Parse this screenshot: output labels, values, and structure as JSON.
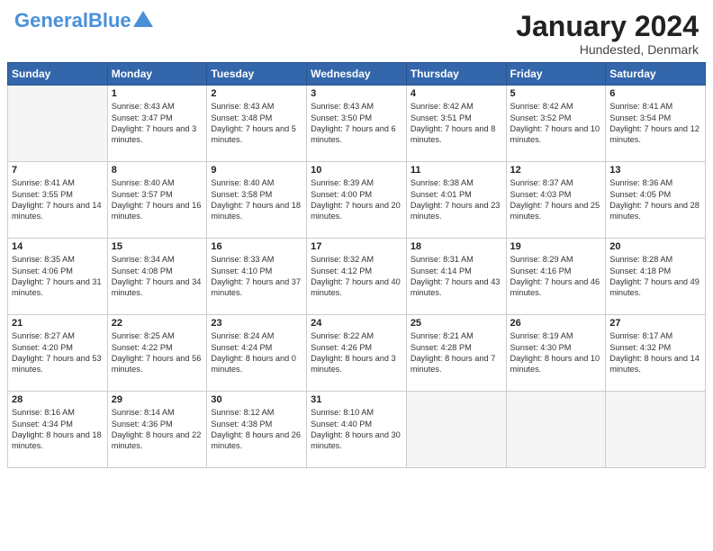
{
  "header": {
    "logo_line1": "General",
    "logo_line2": "Blue",
    "month_title": "January 2024",
    "location": "Hundested, Denmark"
  },
  "weekdays": [
    "Sunday",
    "Monday",
    "Tuesday",
    "Wednesday",
    "Thursday",
    "Friday",
    "Saturday"
  ],
  "weeks": [
    [
      {
        "day": "",
        "sunrise": "",
        "sunset": "",
        "daylight": ""
      },
      {
        "day": "1",
        "sunrise": "Sunrise: 8:43 AM",
        "sunset": "Sunset: 3:47 PM",
        "daylight": "Daylight: 7 hours and 3 minutes."
      },
      {
        "day": "2",
        "sunrise": "Sunrise: 8:43 AM",
        "sunset": "Sunset: 3:48 PM",
        "daylight": "Daylight: 7 hours and 5 minutes."
      },
      {
        "day": "3",
        "sunrise": "Sunrise: 8:43 AM",
        "sunset": "Sunset: 3:50 PM",
        "daylight": "Daylight: 7 hours and 6 minutes."
      },
      {
        "day": "4",
        "sunrise": "Sunrise: 8:42 AM",
        "sunset": "Sunset: 3:51 PM",
        "daylight": "Daylight: 7 hours and 8 minutes."
      },
      {
        "day": "5",
        "sunrise": "Sunrise: 8:42 AM",
        "sunset": "Sunset: 3:52 PM",
        "daylight": "Daylight: 7 hours and 10 minutes."
      },
      {
        "day": "6",
        "sunrise": "Sunrise: 8:41 AM",
        "sunset": "Sunset: 3:54 PM",
        "daylight": "Daylight: 7 hours and 12 minutes."
      }
    ],
    [
      {
        "day": "7",
        "sunrise": "Sunrise: 8:41 AM",
        "sunset": "Sunset: 3:55 PM",
        "daylight": "Daylight: 7 hours and 14 minutes."
      },
      {
        "day": "8",
        "sunrise": "Sunrise: 8:40 AM",
        "sunset": "Sunset: 3:57 PM",
        "daylight": "Daylight: 7 hours and 16 minutes."
      },
      {
        "day": "9",
        "sunrise": "Sunrise: 8:40 AM",
        "sunset": "Sunset: 3:58 PM",
        "daylight": "Daylight: 7 hours and 18 minutes."
      },
      {
        "day": "10",
        "sunrise": "Sunrise: 8:39 AM",
        "sunset": "Sunset: 4:00 PM",
        "daylight": "Daylight: 7 hours and 20 minutes."
      },
      {
        "day": "11",
        "sunrise": "Sunrise: 8:38 AM",
        "sunset": "Sunset: 4:01 PM",
        "daylight": "Daylight: 7 hours and 23 minutes."
      },
      {
        "day": "12",
        "sunrise": "Sunrise: 8:37 AM",
        "sunset": "Sunset: 4:03 PM",
        "daylight": "Daylight: 7 hours and 25 minutes."
      },
      {
        "day": "13",
        "sunrise": "Sunrise: 8:36 AM",
        "sunset": "Sunset: 4:05 PM",
        "daylight": "Daylight: 7 hours and 28 minutes."
      }
    ],
    [
      {
        "day": "14",
        "sunrise": "Sunrise: 8:35 AM",
        "sunset": "Sunset: 4:06 PM",
        "daylight": "Daylight: 7 hours and 31 minutes."
      },
      {
        "day": "15",
        "sunrise": "Sunrise: 8:34 AM",
        "sunset": "Sunset: 4:08 PM",
        "daylight": "Daylight: 7 hours and 34 minutes."
      },
      {
        "day": "16",
        "sunrise": "Sunrise: 8:33 AM",
        "sunset": "Sunset: 4:10 PM",
        "daylight": "Daylight: 7 hours and 37 minutes."
      },
      {
        "day": "17",
        "sunrise": "Sunrise: 8:32 AM",
        "sunset": "Sunset: 4:12 PM",
        "daylight": "Daylight: 7 hours and 40 minutes."
      },
      {
        "day": "18",
        "sunrise": "Sunrise: 8:31 AM",
        "sunset": "Sunset: 4:14 PM",
        "daylight": "Daylight: 7 hours and 43 minutes."
      },
      {
        "day": "19",
        "sunrise": "Sunrise: 8:29 AM",
        "sunset": "Sunset: 4:16 PM",
        "daylight": "Daylight: 7 hours and 46 minutes."
      },
      {
        "day": "20",
        "sunrise": "Sunrise: 8:28 AM",
        "sunset": "Sunset: 4:18 PM",
        "daylight": "Daylight: 7 hours and 49 minutes."
      }
    ],
    [
      {
        "day": "21",
        "sunrise": "Sunrise: 8:27 AM",
        "sunset": "Sunset: 4:20 PM",
        "daylight": "Daylight: 7 hours and 53 minutes."
      },
      {
        "day": "22",
        "sunrise": "Sunrise: 8:25 AM",
        "sunset": "Sunset: 4:22 PM",
        "daylight": "Daylight: 7 hours and 56 minutes."
      },
      {
        "day": "23",
        "sunrise": "Sunrise: 8:24 AM",
        "sunset": "Sunset: 4:24 PM",
        "daylight": "Daylight: 8 hours and 0 minutes."
      },
      {
        "day": "24",
        "sunrise": "Sunrise: 8:22 AM",
        "sunset": "Sunset: 4:26 PM",
        "daylight": "Daylight: 8 hours and 3 minutes."
      },
      {
        "day": "25",
        "sunrise": "Sunrise: 8:21 AM",
        "sunset": "Sunset: 4:28 PM",
        "daylight": "Daylight: 8 hours and 7 minutes."
      },
      {
        "day": "26",
        "sunrise": "Sunrise: 8:19 AM",
        "sunset": "Sunset: 4:30 PM",
        "daylight": "Daylight: 8 hours and 10 minutes."
      },
      {
        "day": "27",
        "sunrise": "Sunrise: 8:17 AM",
        "sunset": "Sunset: 4:32 PM",
        "daylight": "Daylight: 8 hours and 14 minutes."
      }
    ],
    [
      {
        "day": "28",
        "sunrise": "Sunrise: 8:16 AM",
        "sunset": "Sunset: 4:34 PM",
        "daylight": "Daylight: 8 hours and 18 minutes."
      },
      {
        "day": "29",
        "sunrise": "Sunrise: 8:14 AM",
        "sunset": "Sunset: 4:36 PM",
        "daylight": "Daylight: 8 hours and 22 minutes."
      },
      {
        "day": "30",
        "sunrise": "Sunrise: 8:12 AM",
        "sunset": "Sunset: 4:38 PM",
        "daylight": "Daylight: 8 hours and 26 minutes."
      },
      {
        "day": "31",
        "sunrise": "Sunrise: 8:10 AM",
        "sunset": "Sunset: 4:40 PM",
        "daylight": "Daylight: 8 hours and 30 minutes."
      },
      {
        "day": "",
        "sunrise": "",
        "sunset": "",
        "daylight": ""
      },
      {
        "day": "",
        "sunrise": "",
        "sunset": "",
        "daylight": ""
      },
      {
        "day": "",
        "sunrise": "",
        "sunset": "",
        "daylight": ""
      }
    ]
  ]
}
